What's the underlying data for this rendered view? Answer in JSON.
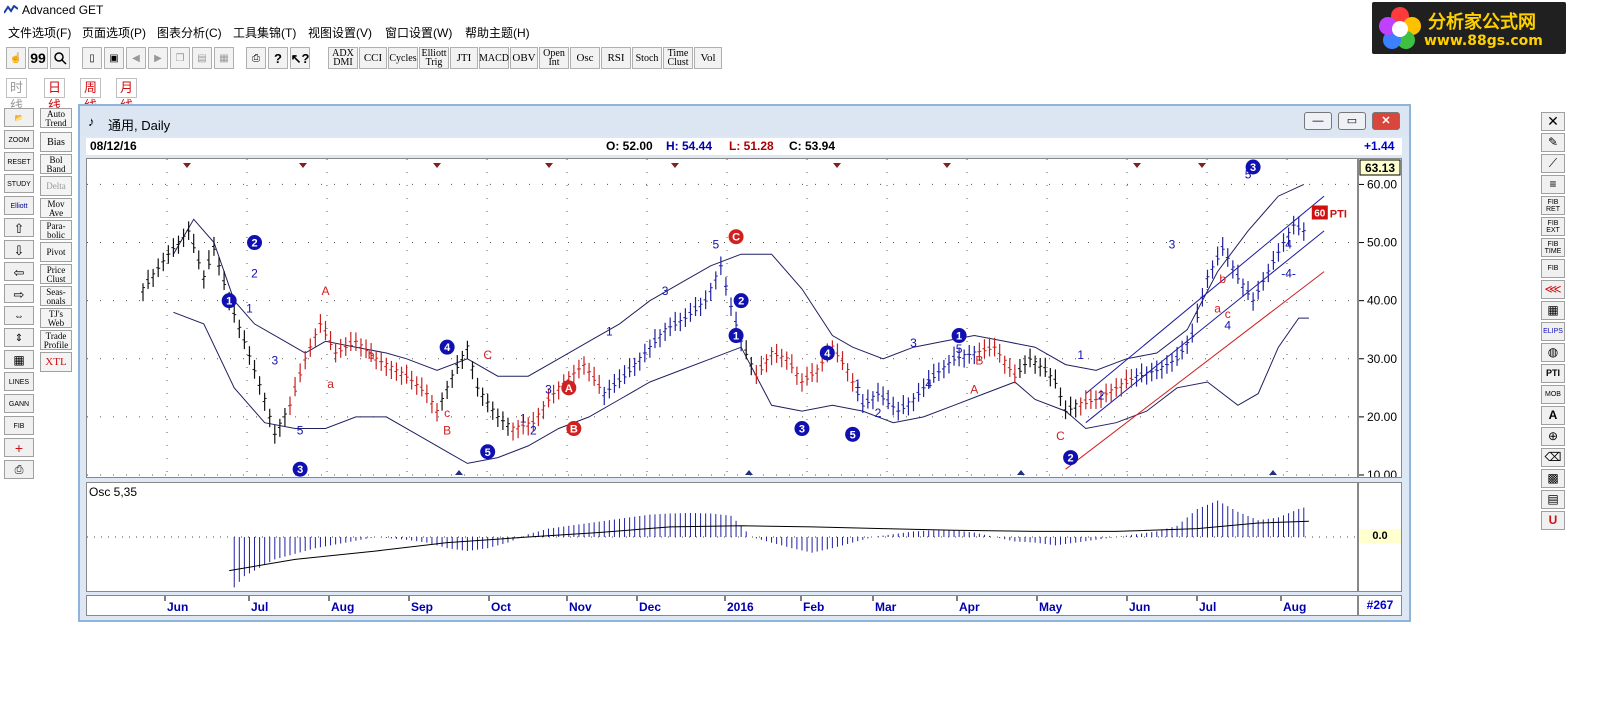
{
  "app": {
    "title": "Advanced GET"
  },
  "menu": [
    "文件选项(F)",
    "页面选项(P)",
    "图表分析(C)",
    "工具集锦(T)",
    "视图设置(V)",
    "窗口设置(W)",
    "帮助主题(H)"
  ],
  "logo": {
    "line1": "分析家公式网",
    "line2": "www.88gs.com"
  },
  "toolbar": {
    "indicators": [
      "ADX DMI",
      "CCI",
      "Cycles",
      "Elliott Trig",
      "JTI",
      "MACD",
      "OBV",
      "Open Int",
      "Osc",
      "RSI",
      "Stoch",
      "Time Clust",
      "Vol"
    ],
    "icons": [
      "cursor-icon",
      "quote-icon",
      "search-icon",
      "new-doc-icon",
      "save-icon",
      "back-icon",
      "forward-icon",
      "copy-icon",
      "paste-icon",
      "print-icon",
      "help-icon",
      "context-help-icon"
    ]
  },
  "periods": [
    "时线",
    "日线",
    "周线",
    "月线"
  ],
  "studies": [
    "Auto Trend",
    "Bias",
    "Bol Band",
    "Delta",
    "Mov Ave",
    "Para- bolic",
    "Pivot",
    "Price Clust",
    "Seas- onals",
    "TJ's Web",
    "Trade Profile",
    "XTL"
  ],
  "left_tools": [
    "OPEN",
    "ZOOM",
    "RESET",
    "STUDY",
    "Elliott",
    "UP",
    "DOWN",
    "LEFT",
    "RIGHT",
    "EXPAND",
    "COMPRESS",
    "GRID",
    "LINES",
    "GANN",
    "FIB",
    "CROSS",
    "PRINT"
  ],
  "right_tools": [
    "SELECT",
    "PEN",
    "LINE",
    "CHANNEL",
    "FIB RET",
    "FIB EXT",
    "FIB TIME",
    "FIB",
    "FAN",
    "GRID",
    "ELIPS",
    "CIRCLE",
    "PTI",
    "MOB",
    "TEXT",
    "ZOOM",
    "ERASE",
    "GRID2",
    "CALC",
    "U"
  ],
  "chart_window": {
    "title": "通用, Daily",
    "date": "08/12/16",
    "open": "O: 52.00",
    "high": "H: 54.44",
    "low": "L: 51.28",
    "close": "C: 53.94",
    "change": "+1.44",
    "last_price": "63.13",
    "osc_label": "Osc 5,35",
    "osc_zero": "0.0",
    "bar_count": "#267",
    "pti_value": "60",
    "pti_label": "PTI"
  },
  "chart_data": {
    "type": "line",
    "y_axis": {
      "ticks": [
        60,
        50,
        40,
        30,
        20,
        10
      ],
      "ylim": [
        10,
        63
      ]
    },
    "x_axis": {
      "ticks": [
        "Jun",
        "Jul",
        "Aug",
        "Sep",
        "Oct",
        "Nov",
        "Dec",
        "2016",
        "Feb",
        "Mar",
        "Apr",
        "May",
        "Jun",
        "Jul",
        "Aug"
      ]
    },
    "price_path": [
      [
        0,
        42
      ],
      [
        5,
        48
      ],
      [
        9,
        52
      ],
      [
        12,
        44
      ],
      [
        14,
        49
      ],
      [
        17,
        40
      ],
      [
        20,
        33
      ],
      [
        24,
        23
      ],
      [
        26,
        17
      ],
      [
        29,
        22
      ],
      [
        32,
        30
      ],
      [
        35,
        36
      ],
      [
        38,
        31
      ],
      [
        42,
        33
      ],
      [
        46,
        30
      ],
      [
        52,
        27
      ],
      [
        56,
        24
      ],
      [
        58,
        21
      ],
      [
        61,
        27
      ],
      [
        64,
        32
      ],
      [
        66,
        25
      ],
      [
        70,
        20
      ],
      [
        73,
        18
      ],
      [
        77,
        19
      ],
      [
        80,
        23
      ],
      [
        83,
        26
      ],
      [
        87,
        29
      ],
      [
        91,
        24
      ],
      [
        95,
        27
      ],
      [
        99,
        31
      ],
      [
        103,
        35
      ],
      [
        107,
        37
      ],
      [
        111,
        40
      ],
      [
        114,
        46
      ],
      [
        116,
        39
      ],
      [
        118,
        33
      ],
      [
        121,
        27
      ],
      [
        124,
        31
      ],
      [
        127,
        30
      ],
      [
        130,
        26
      ],
      [
        133,
        28
      ],
      [
        136,
        32
      ],
      [
        139,
        28
      ],
      [
        142,
        22
      ],
      [
        145,
        24
      ],
      [
        149,
        21
      ],
      [
        152,
        23
      ],
      [
        156,
        27
      ],
      [
        160,
        30
      ],
      [
        164,
        31
      ],
      [
        168,
        32
      ],
      [
        172,
        27
      ],
      [
        175,
        30
      ],
      [
        178,
        28
      ],
      [
        180,
        26
      ],
      [
        182,
        21
      ],
      [
        184,
        22
      ],
      [
        188,
        23
      ],
      [
        192,
        25
      ],
      [
        196,
        27
      ],
      [
        200,
        28
      ],
      [
        204,
        30
      ],
      [
        207,
        34
      ],
      [
        210,
        44
      ],
      [
        213,
        49
      ],
      [
        216,
        44
      ],
      [
        219,
        40
      ],
      [
        222,
        45
      ],
      [
        225,
        50
      ],
      [
        227,
        53
      ],
      [
        229,
        52
      ]
    ],
    "bollinger_upper": [
      [
        6,
        48
      ],
      [
        10,
        54
      ],
      [
        14,
        50
      ],
      [
        18,
        40
      ],
      [
        22,
        36
      ],
      [
        28,
        33
      ],
      [
        32,
        31
      ],
      [
        36,
        33
      ],
      [
        42,
        32
      ],
      [
        48,
        31
      ],
      [
        52,
        30
      ],
      [
        58,
        28
      ],
      [
        64,
        30
      ],
      [
        70,
        27
      ],
      [
        76,
        27
      ],
      [
        82,
        30
      ],
      [
        88,
        33
      ],
      [
        94,
        36
      ],
      [
        100,
        40
      ],
      [
        106,
        43
      ],
      [
        112,
        46
      ],
      [
        118,
        48
      ],
      [
        124,
        48
      ],
      [
        130,
        42
      ],
      [
        136,
        34
      ],
      [
        140,
        32
      ],
      [
        146,
        30
      ],
      [
        152,
        32
      ],
      [
        158,
        33
      ],
      [
        164,
        34
      ],
      [
        170,
        33
      ],
      [
        176,
        32
      ],
      [
        182,
        29
      ],
      [
        188,
        28
      ],
      [
        194,
        30
      ],
      [
        200,
        31
      ],
      [
        206,
        35
      ],
      [
        212,
        45
      ],
      [
        218,
        52
      ],
      [
        224,
        58
      ],
      [
        229,
        60
      ]
    ],
    "bollinger_lower": [
      [
        6,
        38
      ],
      [
        12,
        36
      ],
      [
        18,
        25
      ],
      [
        24,
        19
      ],
      [
        30,
        18
      ],
      [
        36,
        18
      ],
      [
        42,
        20
      ],
      [
        48,
        20
      ],
      [
        54,
        17
      ],
      [
        60,
        14
      ],
      [
        64,
        12
      ],
      [
        70,
        13
      ],
      [
        76,
        15
      ],
      [
        82,
        18
      ],
      [
        88,
        20
      ],
      [
        94,
        23
      ],
      [
        100,
        26
      ],
      [
        106,
        28
      ],
      [
        112,
        30
      ],
      [
        118,
        32
      ],
      [
        124,
        22
      ],
      [
        130,
        21
      ],
      [
        136,
        22
      ],
      [
        142,
        21
      ],
      [
        148,
        19
      ],
      [
        154,
        20
      ],
      [
        160,
        22
      ],
      [
        166,
        24
      ],
      [
        172,
        26
      ],
      [
        176,
        23
      ],
      [
        182,
        21
      ],
      [
        186,
        18
      ],
      [
        192,
        19
      ],
      [
        198,
        21
      ],
      [
        204,
        25
      ],
      [
        210,
        26
      ],
      [
        216,
        22
      ],
      [
        220,
        24
      ],
      [
        224,
        32
      ],
      [
        228,
        37
      ],
      [
        230,
        37
      ]
    ],
    "channel_lines": [
      {
        "color": "#1a1aa0",
        "points": [
          [
            186,
            24
          ],
          [
            233,
            58
          ]
        ]
      },
      {
        "color": "#1a1aa0",
        "points": [
          [
            186,
            19
          ],
          [
            233,
            52
          ]
        ]
      },
      {
        "color": "#d02020",
        "points": [
          [
            182,
            11
          ],
          [
            233,
            45
          ]
        ]
      }
    ],
    "elliott_labels": [
      {
        "x": 22,
        "y": 50,
        "text": "2",
        "circled": true,
        "color": "#1010b0"
      },
      {
        "x": 17,
        "y": 40,
        "text": "1",
        "circled": true,
        "color": "#1010b0"
      },
      {
        "x": 31,
        "y": 11,
        "text": "3",
        "circled": true,
        "color": "#1010b0"
      },
      {
        "x": 60,
        "y": 32,
        "text": "4",
        "circled": true,
        "color": "#1010b0"
      },
      {
        "x": 68,
        "y": 14,
        "text": "5",
        "circled": true,
        "color": "#1010b0"
      },
      {
        "x": 84,
        "y": 25,
        "text": "A",
        "circled": true,
        "color": "#d02020"
      },
      {
        "x": 85,
        "y": 18,
        "text": "B",
        "circled": true,
        "color": "#d02020"
      },
      {
        "x": 117,
        "y": 51,
        "text": "C",
        "circled": true,
        "color": "#d02020"
      },
      {
        "x": 118,
        "y": 40,
        "text": "2",
        "circled": true,
        "color": "#1010b0"
      },
      {
        "x": 117,
        "y": 34,
        "text": "1",
        "circled": true,
        "color": "#1010b0"
      },
      {
        "x": 130,
        "y": 18,
        "text": "3",
        "circled": true,
        "color": "#1010b0"
      },
      {
        "x": 135,
        "y": 31,
        "text": "4",
        "circled": true,
        "color": "#1010b0"
      },
      {
        "x": 140,
        "y": 17,
        "text": "5",
        "circled": true,
        "color": "#1010b0"
      },
      {
        "x": 161,
        "y": 34,
        "text": "1",
        "circled": true,
        "color": "#1010b0"
      },
      {
        "x": 183,
        "y": 13,
        "text": "2",
        "circled": true,
        "color": "#1010b0"
      },
      {
        "x": 219,
        "y": 63,
        "text": "3",
        "circled": true,
        "color": "#1010b0"
      },
      {
        "x": 36,
        "y": 41,
        "text": "A",
        "circled": false,
        "color": "#d02020"
      },
      {
        "x": 68,
        "y": 30,
        "text": "C",
        "circled": false,
        "color": "#d02020"
      },
      {
        "x": 45,
        "y": 30,
        "text": "b",
        "circled": false,
        "color": "#d02020"
      },
      {
        "x": 37,
        "y": 25,
        "text": "a",
        "circled": false,
        "color": "#d02020"
      },
      {
        "x": 60,
        "y": 20,
        "text": "c",
        "circled": false,
        "color": "#d02020"
      },
      {
        "x": 60,
        "y": 17,
        "text": "B",
        "circled": false,
        "color": "#d02020"
      },
      {
        "x": 165,
        "y": 29,
        "text": "B",
        "circled": false,
        "color": "#d02020"
      },
      {
        "x": 164,
        "y": 24,
        "text": "A",
        "circled": false,
        "color": "#d02020"
      },
      {
        "x": 181,
        "y": 16,
        "text": "C",
        "circled": false,
        "color": "#d02020"
      },
      {
        "x": 113,
        "y": 49,
        "text": "5",
        "circled": false,
        "color": "#1010b0"
      },
      {
        "x": 103,
        "y": 41,
        "text": "3",
        "circled": false,
        "color": "#1010b0"
      },
      {
        "x": 92,
        "y": 34,
        "text": "1",
        "circled": false,
        "color": "#1010b0"
      },
      {
        "x": 80,
        "y": 24,
        "text": "3",
        "circled": false,
        "color": "#1010b0"
      },
      {
        "x": 75,
        "y": 19,
        "text": "1",
        "circled": false,
        "color": "#1010b0"
      },
      {
        "x": 77,
        "y": 17,
        "text": "2",
        "circled": false,
        "color": "#1010b0"
      },
      {
        "x": 31,
        "y": 17,
        "text": "5",
        "circled": false,
        "color": "#1010b0"
      },
      {
        "x": 22,
        "y": 44,
        "text": "2",
        "circled": false,
        "color": "#1010b0"
      },
      {
        "x": 21,
        "y": 38,
        "text": "1",
        "circled": false,
        "color": "#1010b0"
      },
      {
        "x": 26,
        "y": 29,
        "text": "3",
        "circled": false,
        "color": "#1010b0"
      },
      {
        "x": 152,
        "y": 32,
        "text": "3",
        "circled": false,
        "color": "#1010b0"
      },
      {
        "x": 161,
        "y": 31,
        "text": "5",
        "circled": false,
        "color": "#1010b0"
      },
      {
        "x": 155,
        "y": 25,
        "text": "4",
        "circled": false,
        "color": "#1010b0"
      },
      {
        "x": 141,
        "y": 25,
        "text": "1",
        "circled": false,
        "color": "#1010b0"
      },
      {
        "x": 145,
        "y": 20,
        "text": "2",
        "circled": false,
        "color": "#1010b0"
      },
      {
        "x": 185,
        "y": 30,
        "text": "1",
        "circled": false,
        "color": "#1010b0"
      },
      {
        "x": 189,
        "y": 23,
        "text": "2",
        "circled": false,
        "color": "#1010b0"
      },
      {
        "x": 203,
        "y": 49,
        "text": "3",
        "circled": false,
        "color": "#1010b0"
      },
      {
        "x": 218,
        "y": 61,
        "text": "5",
        "circled": false,
        "color": "#1010b0"
      },
      {
        "x": 214,
        "y": 35,
        "text": "4",
        "circled": false,
        "color": "#1010b0"
      },
      {
        "x": 212,
        "y": 38,
        "text": "a",
        "circled": false,
        "color": "#d02020"
      },
      {
        "x": 213,
        "y": 43,
        "text": "b",
        "circled": false,
        "color": "#d02020"
      },
      {
        "x": 214,
        "y": 37,
        "text": "c",
        "circled": false,
        "color": "#d02020"
      },
      {
        "x": 226,
        "y": 49,
        "text": "4",
        "circled": false,
        "color": "#1010b0"
      },
      {
        "x": 226,
        "y": 44,
        "text": "-4-",
        "circled": false,
        "color": "#1010b0"
      }
    ],
    "oscillator": [
      [
        17,
        0
      ],
      [
        18,
        -0.9
      ],
      [
        19,
        -0.8
      ],
      [
        20,
        -0.7
      ],
      [
        22,
        -0.6
      ],
      [
        24,
        -0.5
      ],
      [
        26,
        -0.4
      ],
      [
        30,
        -0.3
      ],
      [
        34,
        -0.2
      ],
      [
        40,
        -0.1
      ],
      [
        46,
        0
      ],
      [
        52,
        -0.05
      ],
      [
        56,
        -0.1
      ],
      [
        60,
        -0.2
      ],
      [
        64,
        -0.25
      ],
      [
        68,
        -0.2
      ],
      [
        72,
        -0.1
      ],
      [
        76,
        0.05
      ],
      [
        80,
        0.15
      ],
      [
        84,
        0.2
      ],
      [
        88,
        0.25
      ],
      [
        92,
        0.3
      ],
      [
        96,
        0.35
      ],
      [
        100,
        0.4
      ],
      [
        104,
        0.42
      ],
      [
        108,
        0.43
      ],
      [
        112,
        0.42
      ],
      [
        116,
        0.38
      ],
      [
        118,
        0.2
      ],
      [
        120,
        0
      ],
      [
        124,
        -0.1
      ],
      [
        128,
        -0.2
      ],
      [
        132,
        -0.28
      ],
      [
        136,
        -0.2
      ],
      [
        140,
        -0.1
      ],
      [
        144,
        0
      ],
      [
        148,
        0.05
      ],
      [
        152,
        0.1
      ],
      [
        156,
        0.12
      ],
      [
        160,
        0.12
      ],
      [
        164,
        0.08
      ],
      [
        168,
        0
      ],
      [
        172,
        -0.08
      ],
      [
        176,
        -0.1
      ],
      [
        180,
        -0.15
      ],
      [
        184,
        -0.1
      ],
      [
        188,
        -0.05
      ],
      [
        192,
        0
      ],
      [
        196,
        0.05
      ],
      [
        200,
        0.1
      ],
      [
        204,
        0.2
      ],
      [
        208,
        0.5
      ],
      [
        212,
        0.65
      ],
      [
        216,
        0.45
      ],
      [
        220,
        0.3
      ],
      [
        224,
        0.35
      ],
      [
        228,
        0.5
      ],
      [
        230,
        0.55
      ]
    ],
    "osc_signal": [
      [
        17,
        -0.6
      ],
      [
        30,
        -0.4
      ],
      [
        46,
        -0.25
      ],
      [
        60,
        -0.1
      ],
      [
        76,
        0
      ],
      [
        90,
        0.08
      ],
      [
        104,
        0.18
      ],
      [
        118,
        0.2
      ],
      [
        132,
        0.18
      ],
      [
        146,
        0.15
      ],
      [
        160,
        0.12
      ],
      [
        176,
        0.1
      ],
      [
        192,
        0.1
      ],
      [
        208,
        0.15
      ],
      [
        220,
        0.25
      ],
      [
        230,
        0.28
      ]
    ]
  }
}
